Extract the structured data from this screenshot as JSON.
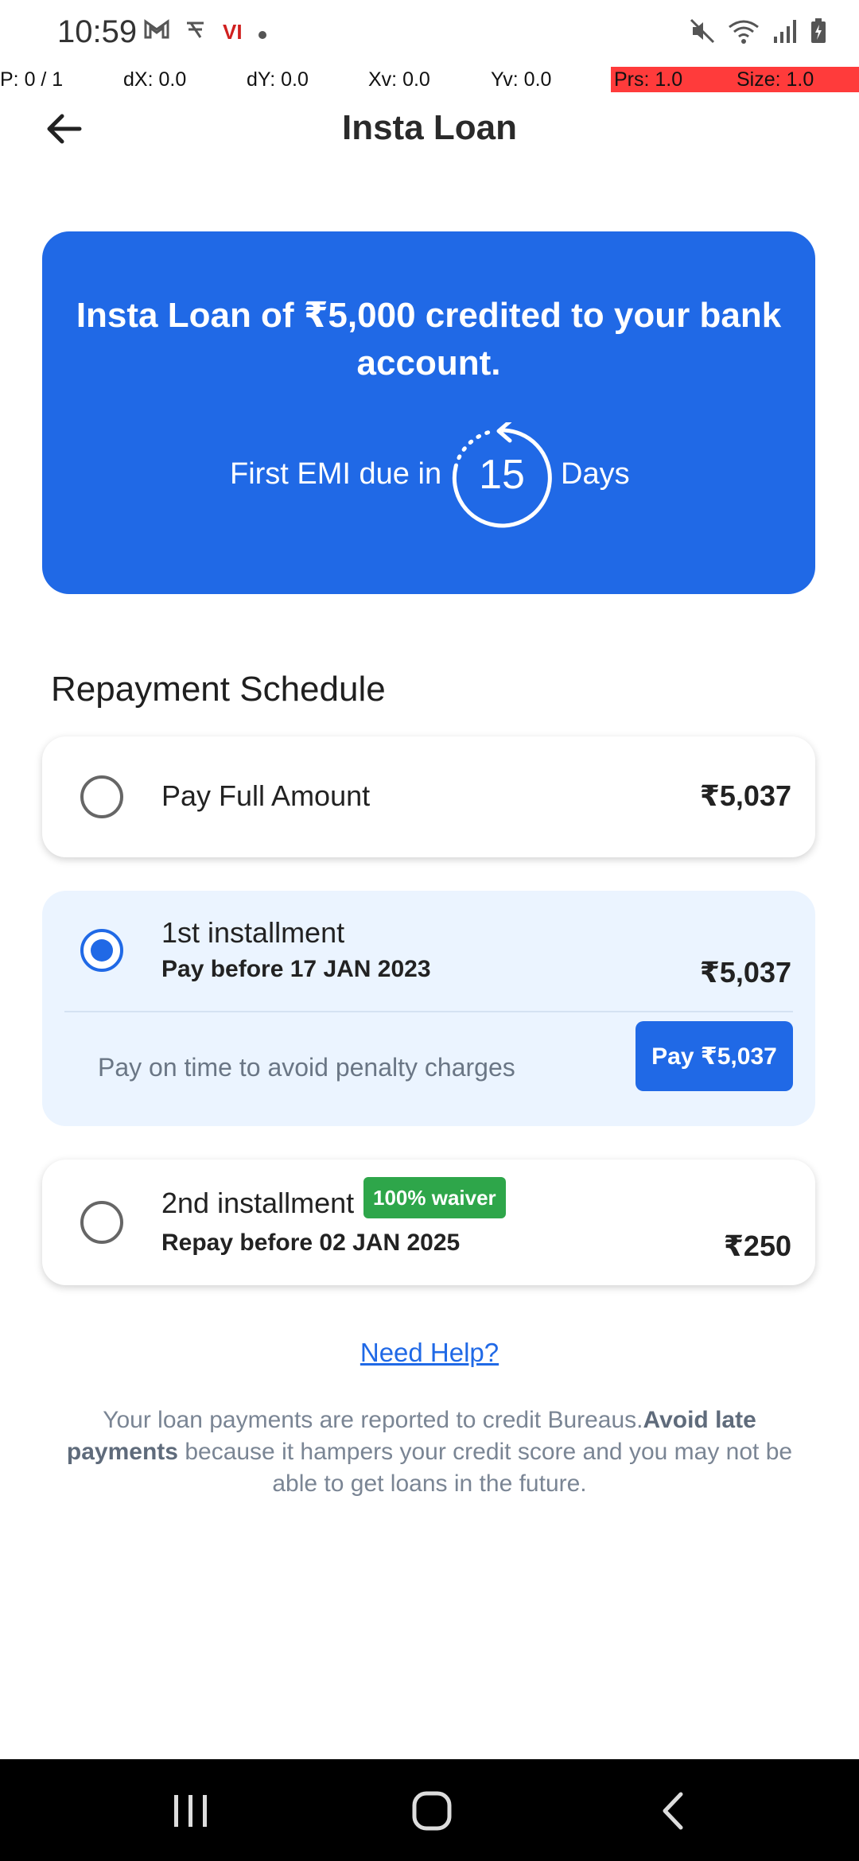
{
  "status_bar": {
    "time": "10:59",
    "left_icons": [
      "gmail-icon",
      "app-icon",
      "vi-icon",
      "dot-icon"
    ],
    "vi_label": "VI",
    "right_icons": [
      "mute-icon",
      "wifi-icon",
      "signal-icon",
      "battery-icon"
    ]
  },
  "debug": {
    "p": "P: 0 / 1",
    "dx": "dX: 0.0",
    "dy": "dY: 0.0",
    "xv": "Xv: 0.0",
    "yv": "Yv: 0.0",
    "prs": "Prs: 1.0",
    "size": "Size: 1.0"
  },
  "header": {
    "title": "Insta Loan"
  },
  "hero": {
    "message": "Insta Loan of ₹5,000 credited to your bank account.",
    "emi_prefix": "First EMI due in",
    "emi_days": "15",
    "emi_suffix": "Days",
    "color": "#2069e6"
  },
  "repayment": {
    "section_title": "Repayment Schedule",
    "full": {
      "label": "Pay Full Amount",
      "amount": "₹5,037",
      "selected": false
    },
    "installment1": {
      "label": "1st installment",
      "due": "Pay before 17 JAN 2023",
      "amount": "₹5,037",
      "selected": true,
      "note": "Pay on time to avoid penalty charges",
      "pay_button": "Pay ₹5,037"
    },
    "installment2": {
      "label": "2nd installment",
      "badge": "100% waiver",
      "due": "Repay before 02 JAN 2025",
      "amount": "₹250",
      "selected": false
    }
  },
  "help": {
    "link": "Need Help?"
  },
  "disclaimer": {
    "part1": "Your loan payments are reported to credit Bureaus.",
    "bold": "Avoid late payments",
    "part2": " because it hampers your credit score and you may not be able to get loans in the future."
  },
  "nav": {
    "items": [
      "recents-icon",
      "home-icon",
      "back-icon"
    ]
  }
}
